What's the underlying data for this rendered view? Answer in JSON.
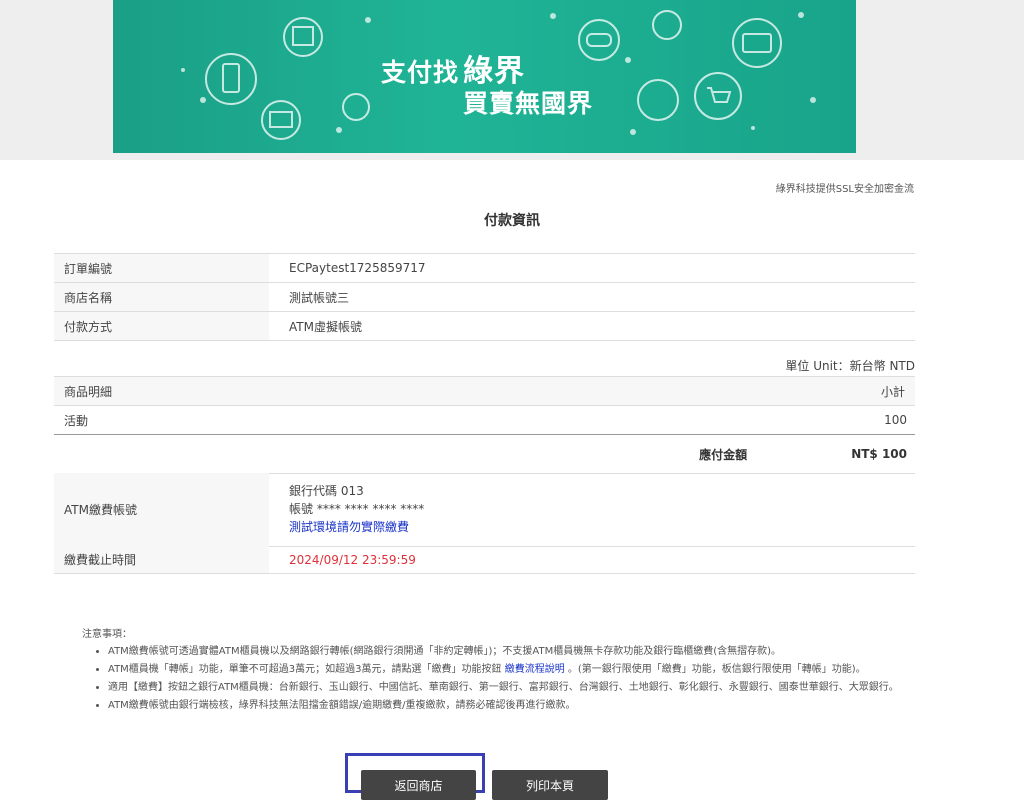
{
  "banner": {
    "slogan_prefix": "支付找",
    "brand": "綠界",
    "slogan_line2": "買賣無國界",
    "icons": [
      "shop-icon",
      "mobile-phone-icon",
      "barcode-icon",
      "globe-icon",
      "gamepad-icon",
      "credit-card-icon",
      "cloud-download-icon",
      "cart-icon",
      "wallet-icon"
    ]
  },
  "ssl_note": "綠界科技提供SSL安全加密金流",
  "page_title": "付款資訊",
  "order_info": [
    {
      "label": "訂單編號",
      "value": "ECPaytest1725859717"
    },
    {
      "label": "商店名稱",
      "value": "測試帳號三"
    },
    {
      "label": "付款方式",
      "value": "ATM虛擬帳號"
    }
  ],
  "unit_note": "單位 Unit：新台幣 NTD",
  "items": {
    "header_name": "商品明細",
    "header_subtotal": "小計",
    "rows": [
      {
        "name": "活動",
        "subtotal": "100"
      }
    ],
    "total_label": "應付金額",
    "total_value": "NT$ 100"
  },
  "atm": {
    "label": "ATM繳費帳號",
    "bank_code": "銀行代碼 013",
    "account": "帳號 **** **** **** ****",
    "warning": "測試環境請勿實際繳費"
  },
  "deadline": {
    "label": "繳費截止時間",
    "value": "2024/09/12 23:59:59"
  },
  "notes": {
    "heading": "注意事項：",
    "n1": "ATM繳費帳號可透過實體ATM櫃員機以及網路銀行轉帳(網路銀行須開通「非約定轉帳」)；不支援ATM櫃員機無卡存款功能及銀行臨櫃繳費(含無摺存款)。",
    "n2_pre": "ATM櫃員機「轉帳」功能，單筆不可超過3萬元；如超過3萬元，請點選「繳費」功能按鈕",
    "n2_link": "繳費流程說明",
    "n2_post": "。(第一銀行限使用「繳費」功能，板信銀行限使用「轉帳」功能)。",
    "n3": "適用【繳費】按鈕之銀行ATM櫃員機：台新銀行、玉山銀行、中國信託、華南銀行、第一銀行、富邦銀行、台灣銀行、土地銀行、彰化銀行、永豐銀行、國泰世華銀行、大眾銀行。",
    "n4": "ATM繳費帳號由銀行端檢核，綠界科技無法阻擋金額錯誤/逾期繳費/重複繳款，請務必確認後再進行繳款。"
  },
  "buttons": {
    "back": "返回商店",
    "print": "列印本頁"
  },
  "colors": {
    "banner": "#20b496",
    "deadline": "#e0303a",
    "link": "#1a33c8",
    "button": "#444444",
    "focus": "#3b3fb4"
  }
}
